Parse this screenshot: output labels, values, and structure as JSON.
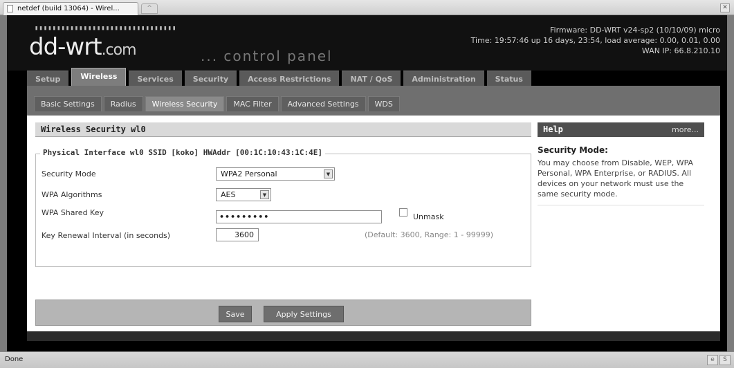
{
  "browser": {
    "tab_title": "netdef (build 13064) - Wirel...",
    "new_tab_icon": "plus-icon",
    "close_icon": "close-icon"
  },
  "header": {
    "logo_main": "dd-wrt",
    "logo_suffix": ".com",
    "control_panel": "... control panel",
    "firmware": "Firmware: DD-WRT v24-sp2 (10/10/09) micro",
    "time": "Time: 19:57:46 up 16 days, 23:54, load average: 0.00, 0.01, 0.00",
    "wan_ip": "WAN IP: 66.8.210.10"
  },
  "main_nav": [
    {
      "label": "Setup"
    },
    {
      "label": "Wireless"
    },
    {
      "label": "Services"
    },
    {
      "label": "Security"
    },
    {
      "label": "Access Restrictions"
    },
    {
      "label": "NAT / QoS"
    },
    {
      "label": "Administration"
    },
    {
      "label": "Status"
    }
  ],
  "sub_nav": [
    {
      "label": "Basic Settings"
    },
    {
      "label": "Radius"
    },
    {
      "label": "Wireless Security"
    },
    {
      "label": "MAC Filter"
    },
    {
      "label": "Advanced Settings"
    },
    {
      "label": "WDS"
    }
  ],
  "section": {
    "title": "Wireless Security wl0",
    "legend": "Physical Interface wl0 SSID [koko] HWAddr [00:1C:10:43:1C:4E]",
    "fields": {
      "security_mode": {
        "label": "Security Mode",
        "value": "WPA2 Personal"
      },
      "wpa_algorithms": {
        "label": "WPA Algorithms",
        "value": "AES"
      },
      "wpa_shared_key": {
        "label": "WPA Shared Key",
        "value": "•••••••••",
        "unmask_label": "Unmask"
      },
      "key_renewal": {
        "label": "Key Renewal Interval (in seconds)",
        "value": "3600",
        "hint": "(Default: 3600, Range: 1 - 99999)"
      }
    },
    "buttons": {
      "save": "Save",
      "apply": "Apply Settings"
    }
  },
  "help": {
    "title": "Help",
    "more": "more...",
    "heading": "Security Mode:",
    "body": "You may choose from Disable, WEP, WPA Personal, WPA Enterprise, or RADIUS. All devices on your network must use the same security mode."
  },
  "statusbar": {
    "text": "Done",
    "icon1": "e",
    "icon2": "S"
  }
}
